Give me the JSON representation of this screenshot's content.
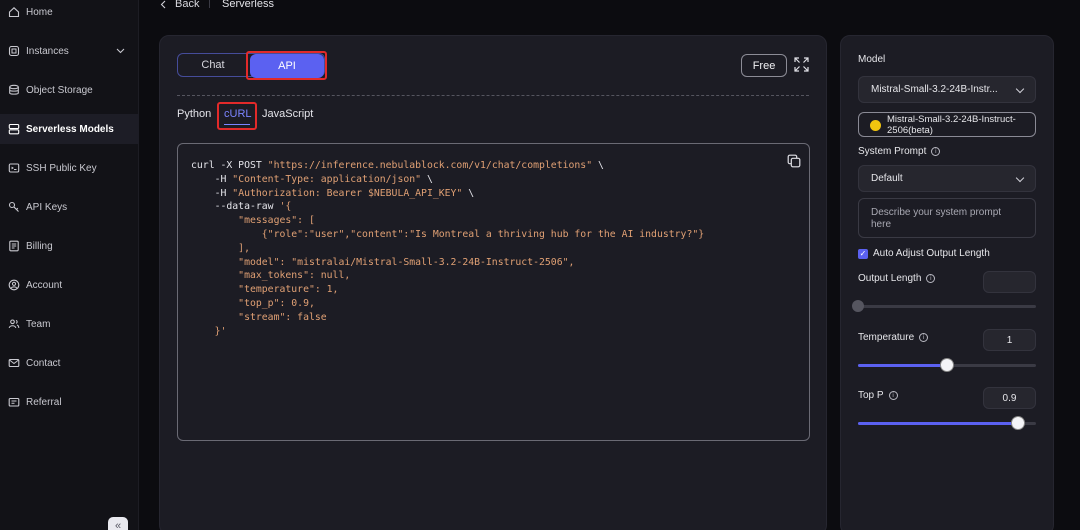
{
  "sidebar": {
    "items": [
      {
        "label": "Home",
        "icon": "home-icon"
      },
      {
        "label": "Instances",
        "icon": "instances-icon"
      },
      {
        "label": "Object Storage",
        "icon": "database-icon"
      },
      {
        "label": "Serverless Models",
        "icon": "serverless-icon"
      },
      {
        "label": "SSH Public Key",
        "icon": "ssh-key-icon"
      },
      {
        "label": "API Keys",
        "icon": "key-icon"
      },
      {
        "label": "Billing",
        "icon": "billing-icon"
      },
      {
        "label": "Account",
        "icon": "account-icon"
      },
      {
        "label": "Team",
        "icon": "team-icon"
      },
      {
        "label": "Contact",
        "icon": "contact-icon"
      },
      {
        "label": "Referral",
        "icon": "referral-icon"
      }
    ],
    "active": "Serverless Models",
    "collapse_label": "«"
  },
  "topbar": {
    "back_label": "Back",
    "title": "Serverless"
  },
  "main": {
    "mode_tabs": {
      "chat": "Chat",
      "api": "API",
      "selected": "API"
    },
    "free_label": "Free",
    "lang_tabs": {
      "python": "Python",
      "curl": "cURL",
      "javascript": "JavaScript",
      "selected": "cURL"
    },
    "code": {
      "l1a": "curl -X POST ",
      "l1b": "\"https://inference.nebulablock.com/v1/chat/completions\"",
      "l1c": " \\",
      "l2a": "    -H ",
      "l2b": "\"Content-Type: application/json\"",
      "l2c": " \\",
      "l3a": "    -H ",
      "l3b": "\"Authorization: Bearer $NEBULA_API_KEY\"",
      "l3c": " \\",
      "l4a": "    --data-raw ",
      "l4b": "'{",
      "l5": "        \"messages\": [",
      "l6": "            {\"role\":\"user\",\"content\":\"Is Montreal a thriving hub for the AI industry?\"}",
      "l7": "        ],",
      "l8": "        \"model\": \"mistralai/Mistral-Small-3.2-24B-Instruct-2506\",",
      "l9": "        \"max_tokens\": null,",
      "l10": "        \"temperature\": 1,",
      "l11": "        \"top_p\": 0.9,",
      "l12": "        \"stream\": false",
      "l13": "    }'"
    }
  },
  "settings": {
    "model_label": "Model",
    "model_selected": "Mistral-Small-3.2-24B-Instr...",
    "model_badge": "Mistral-Small-3.2-24B-Instruct-2506(beta)",
    "system_prompt_label": "System Prompt",
    "system_prompt_selected": "Default",
    "system_prompt_placeholder": "Describe your system prompt here",
    "auto_adjust_label": "Auto Adjust Output Length",
    "auto_adjust_checked": true,
    "output_length_label": "Output Length",
    "output_length_value": "",
    "output_length_level": 0,
    "temperature_label": "Temperature",
    "temperature_value": "1",
    "temperature_level": 0.5,
    "top_p_label": "Top P",
    "top_p_value": "0.9",
    "top_p_level": 0.9
  },
  "colors": {
    "accent": "#5b61f1",
    "highlight": "#e22a2a",
    "string": "#e0a074"
  }
}
